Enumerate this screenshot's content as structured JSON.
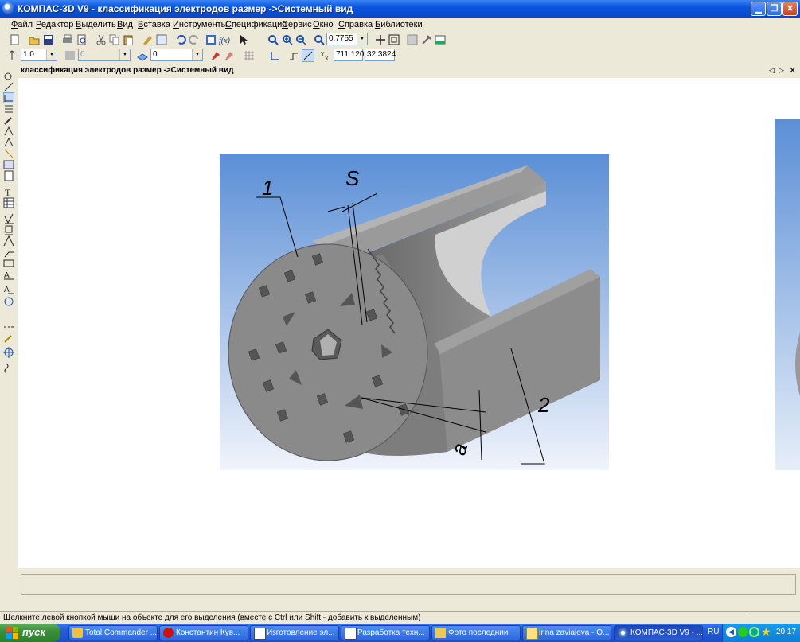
{
  "window": {
    "title": "КОМПАС-3D V9 - классификация электродов размер ->Системный вид",
    "minimize_icon": "minimize-icon",
    "maximize_icon": "maximize-icon",
    "close_icon": "close-icon"
  },
  "menu": [
    "Файл",
    "Редактор",
    "Выделить",
    "Вид",
    "Вставка",
    "Инструменты",
    "Спецификация",
    "Сервис",
    "Окно",
    "Справка",
    "Библиотеки"
  ],
  "toolbar1": {
    "zoom_value": "0.7755"
  },
  "toolbar2": {
    "step_value": "1.0",
    "style_value": "0",
    "layer_value": "0",
    "coord_x": "711.120",
    "coord_y": "32.3824"
  },
  "document": {
    "tab_title": "классификация электродов размер ->Системный вид"
  },
  "drawing": {
    "label_1": "1",
    "label_2": "2",
    "label_s": "S",
    "label_a": "a"
  },
  "colors": {
    "face": "#8a8a8a",
    "sky_top": "#5b8fd6",
    "sky_bottom": "#f0f4fb"
  },
  "status": {
    "hint": "Щелкните левой кнопкой мыши на объекте для его выделения (вместе с Ctrl или Shift - добавить к выделенным)"
  },
  "taskbar": {
    "start_label": "пуск",
    "items": [
      {
        "label": "Total Commander ...",
        "icon": "total-commander-icon"
      },
      {
        "label": "Константин Кув...",
        "icon": "opera-icon"
      },
      {
        "label": "Изготовление эл...",
        "icon": "document-icon"
      },
      {
        "label": "Разработка техн...",
        "icon": "document-icon"
      },
      {
        "label": "Фото последнии",
        "icon": "folder-icon"
      },
      {
        "label": "irina zavialova - О...",
        "icon": "mail-icon"
      },
      {
        "label": "КОМПАС-3D V9 - ...",
        "icon": "kompas-icon"
      }
    ],
    "lang": "RU",
    "clock": "20:17"
  }
}
